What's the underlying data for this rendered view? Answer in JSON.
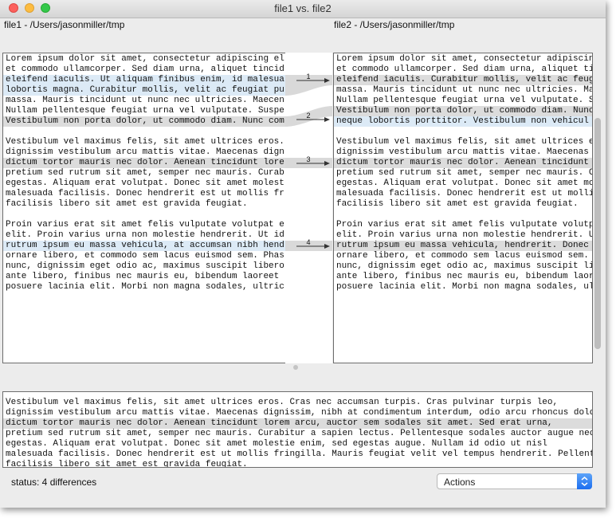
{
  "window": {
    "title": "file1 vs. file2"
  },
  "left_pane": {
    "header": "file1 - /Users/jasonmiller/tmp",
    "lines": [
      {
        "text": "Lorem ipsum dolor sit amet, consectetur adipiscing el",
        "hl": ""
      },
      {
        "text": "et commodo ullamcorper. Sed diam urna, aliquet tincid",
        "hl": ""
      },
      {
        "text": "eleifend iaculis. Ut aliquam finibus enim, id malesua",
        "hl": "blue"
      },
      {
        "text": "lobortis magna. Curabitur mollis, velit ac feugiat pu",
        "hl": "blue"
      },
      {
        "text": "massa. Mauris tincidunt ut nunc nec ultricies. Maecen",
        "hl": ""
      },
      {
        "text": "Nullam pellentesque feugiat urna vel vulputate. Suspe",
        "hl": ""
      },
      {
        "text": "Vestibulum non porta dolor, ut commodo diam. Nunc com",
        "hl": "grey"
      },
      {
        "text": "",
        "hl": ""
      },
      {
        "text": "Vestibulum vel maximus felis, sit amet ultrices eros.",
        "hl": ""
      },
      {
        "text": "dignissim vestibulum arcu mattis vitae. Maecenas dign",
        "hl": ""
      },
      {
        "text": "dictum tortor mauris nec dolor. Aenean tincidunt lore",
        "hl": "grey"
      },
      {
        "text": "pretium sed rutrum sit amet, semper nec mauris. Curab",
        "hl": ""
      },
      {
        "text": "egestas. Aliquam erat volutpat. Donec sit amet molest",
        "hl": ""
      },
      {
        "text": "malesuada facilisis. Donec hendrerit est ut mollis fr",
        "hl": ""
      },
      {
        "text": "facilisis libero sit amet est gravida feugiat.",
        "hl": ""
      },
      {
        "text": "",
        "hl": ""
      },
      {
        "text": "Proin varius erat sit amet felis vulputate volutpat e",
        "hl": ""
      },
      {
        "text": "elit. Proin varius urna non molestie hendrerit. Ut id",
        "hl": ""
      },
      {
        "text": "rutrum ipsum eu massa vehicula, at accumsan nibh hend",
        "hl": "blue"
      },
      {
        "text": "ornare libero, et commodo sem lacus euismod sem. Phas",
        "hl": ""
      },
      {
        "text": "nunc, dignissim eget odio ac, maximus suscipit libero",
        "hl": ""
      },
      {
        "text": "ante libero, finibus nec mauris eu, bibendum laoreet ",
        "hl": ""
      },
      {
        "text": "posuere lacinia elit. Morbi non magna sodales, ultric",
        "hl": ""
      }
    ]
  },
  "right_pane": {
    "header": "file2 - /Users/jasonmiller/tmp",
    "lines": [
      {
        "text": "Lorem ipsum dolor sit amet, consectetur adipiscing el",
        "hl": ""
      },
      {
        "text": "et commodo ullamcorper. Sed diam urna, aliquet tincid",
        "hl": ""
      },
      {
        "text": "eleifend iaculis. Curabitur mollis, velit ac feugi",
        "hl": "grey"
      },
      {
        "text": "massa. Mauris tincidunt ut nunc nec ultricies. Maecen",
        "hl": ""
      },
      {
        "text": "Nullam pellentesque feugiat urna vel vulputate. Suspe",
        "hl": ""
      },
      {
        "text": "Vestibulum non porta dolor, ut commodo diam. Nunc com",
        "hl": "grey"
      },
      {
        "text": "neque lobortis porttitor. Vestibulum non vehicul",
        "hl": "blue"
      },
      {
        "text": "",
        "hl": ""
      },
      {
        "text": "Vestibulum vel maximus felis, sit amet ultrices eros.",
        "hl": ""
      },
      {
        "text": "dignissim vestibulum arcu mattis vitae. Maecenas dign",
        "hl": ""
      },
      {
        "text": "dictum tortor mauris nec dolor. Aenean tincidunt lore",
        "hl": "grey"
      },
      {
        "text": "pretium sed rutrum sit amet, semper nec mauris. Curab",
        "hl": ""
      },
      {
        "text": "egestas. Aliquam erat volutpat. Donec sit amet molest",
        "hl": ""
      },
      {
        "text": "malesuada facilisis. Donec hendrerit est ut mollis fr",
        "hl": ""
      },
      {
        "text": "facilisis libero sit amet est gravida feugiat.",
        "hl": ""
      },
      {
        "text": "",
        "hl": ""
      },
      {
        "text": "Proin varius erat sit amet felis vulputate volutpat e",
        "hl": ""
      },
      {
        "text": "elit. Proin varius urna non molestie hendrerit. Ut id",
        "hl": ""
      },
      {
        "text": "rutrum ipsum eu massa vehicula, hendrerit. Donec",
        "hl": "grey"
      },
      {
        "text": "ornare libero, et commodo sem lacus euismod sem. Phas",
        "hl": ""
      },
      {
        "text": "nunc, dignissim eget odio ac, maximus suscipit libero",
        "hl": ""
      },
      {
        "text": "ante libero, finibus nec mauris eu, bibendum laoreet ",
        "hl": ""
      },
      {
        "text": "posuere lacinia elit. Morbi non magna sodales, ultric",
        "hl": ""
      }
    ]
  },
  "connector": {
    "labels": [
      "1",
      "2",
      "3",
      "4"
    ]
  },
  "bottom_pane": {
    "lines": [
      {
        "text": "Vestibulum vel maximus felis, sit amet ultrices eros. Cras nec accumsan turpis. Cras pulvinar turpis leo,",
        "hl": ""
      },
      {
        "text": "dignissim vestibulum arcu mattis vitae. Maecenas dignissim, nibh at condimentum interdum, odio arcu rhoncus dolo",
        "hl": ""
      },
      {
        "text": "dictum tortor mauris nec dolor. Aenean tincidunt lorem arcu, auctor sem sodales sit amet. Sed erat urna,",
        "hl": "grey"
      },
      {
        "text": "pretium sed rutrum sit amet, semper nec mauris. Curabitur a sapien lectus. Pellentesque sodales auctor augue nec",
        "hl": ""
      },
      {
        "text": "egestas. Aliquam erat volutpat. Donec sit amet molestie enim, sed egestas augue. Nullam id odio ut nisl",
        "hl": ""
      },
      {
        "text": "malesuada facilisis. Donec hendrerit est ut mollis fringilla. Mauris feugiat velit vel tempus hendrerit. Pellent",
        "hl": ""
      },
      {
        "text": "facilisis libero sit amet est gravida feugiat.",
        "hl": ""
      }
    ]
  },
  "status": {
    "text": "status: 4 differences"
  },
  "actions": {
    "label": "Actions"
  },
  "colors": {
    "blue_highlight": "#dceaf6",
    "grey_highlight": "#dcdcdc",
    "select_accent": "#1c6ef0"
  }
}
